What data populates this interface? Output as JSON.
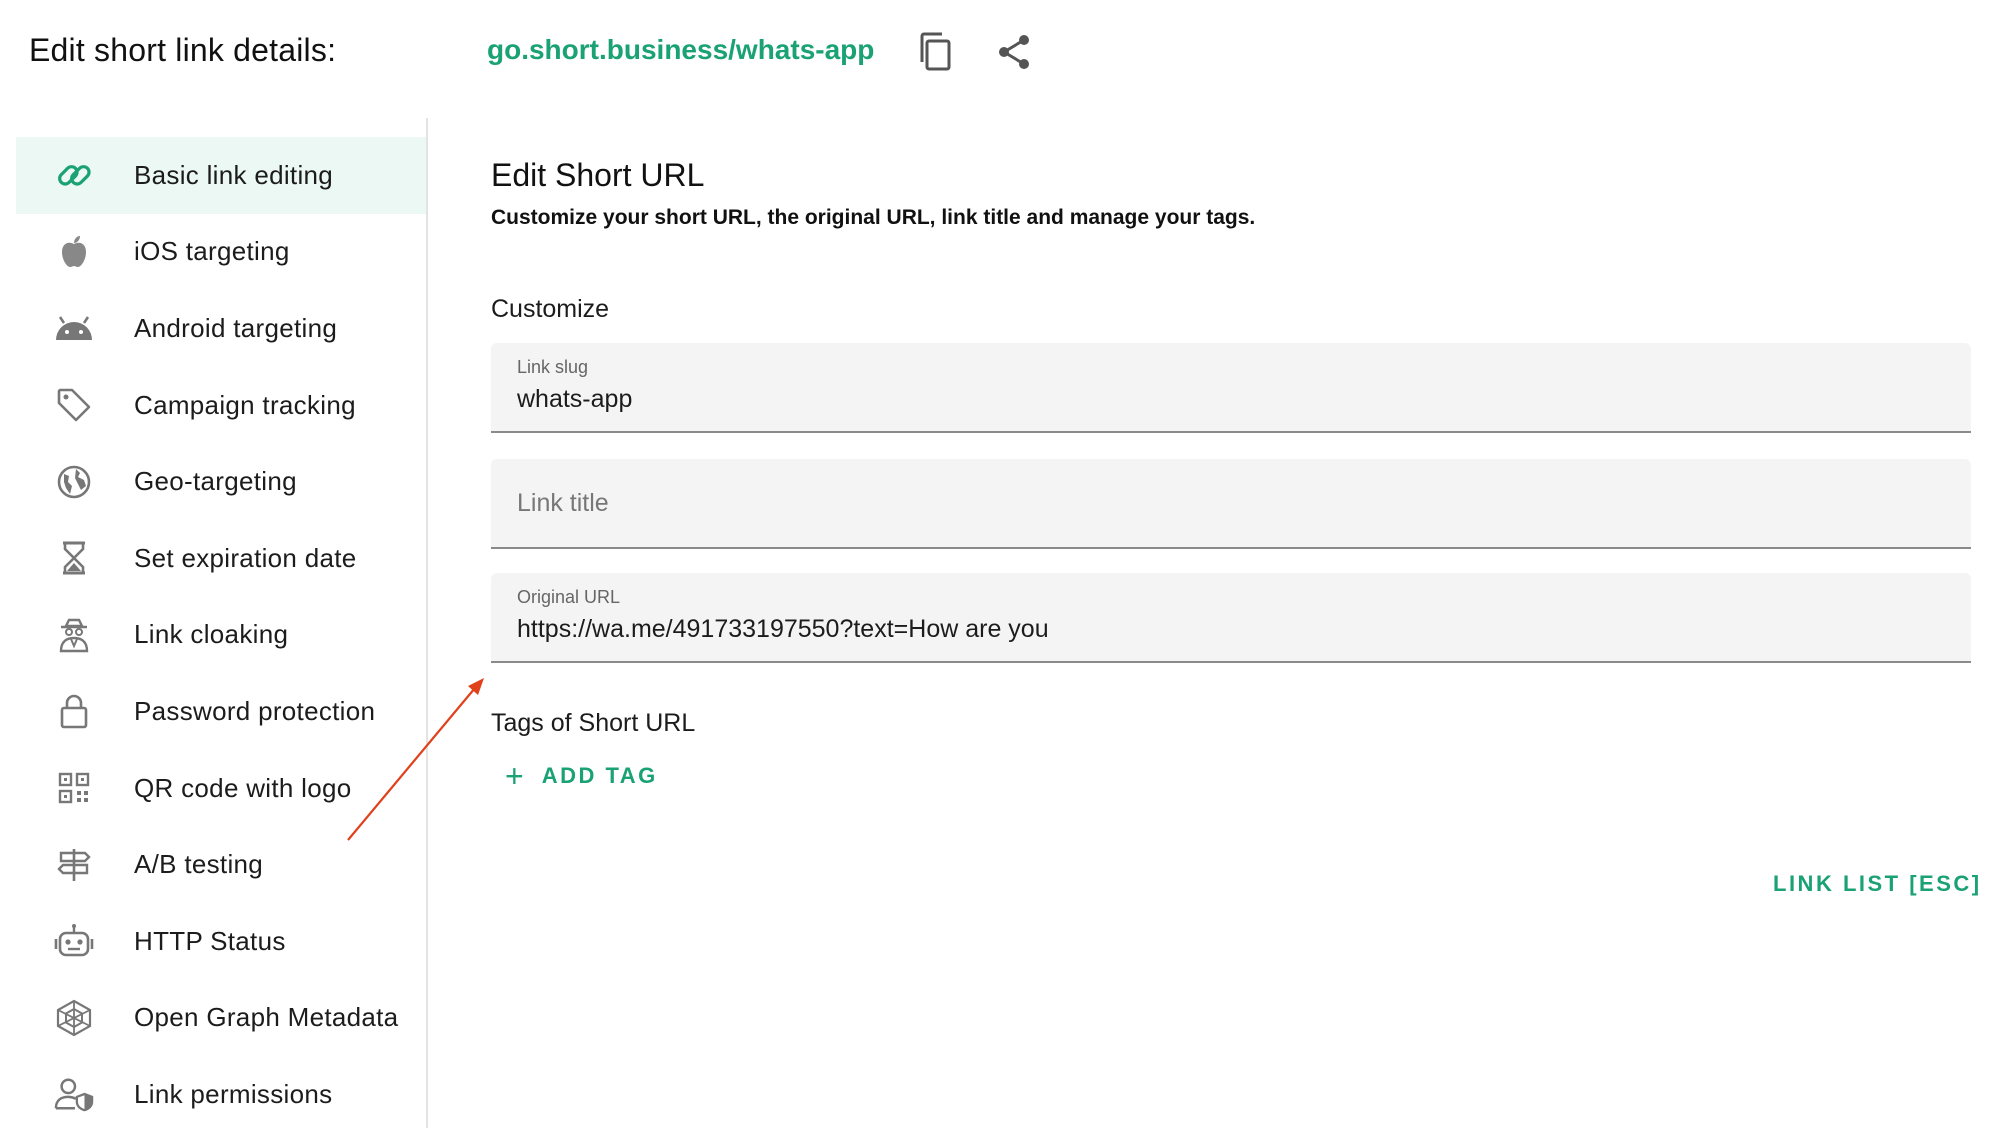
{
  "header": {
    "title": "Edit short link details:",
    "short_url": "go.short.business/whats-app",
    "copy_icon": "copy-icon",
    "share_icon": "share-icon"
  },
  "sidebar": {
    "items": [
      {
        "label": "Basic link editing",
        "icon": "link-icon",
        "active": true
      },
      {
        "label": "iOS targeting",
        "icon": "apple-icon"
      },
      {
        "label": "Android targeting",
        "icon": "android-icon"
      },
      {
        "label": "Campaign tracking",
        "icon": "tag-icon"
      },
      {
        "label": "Geo-targeting",
        "icon": "globe-icon"
      },
      {
        "label": "Set expiration date",
        "icon": "hourglass-icon"
      },
      {
        "label": "Link cloaking",
        "icon": "spy-icon"
      },
      {
        "label": "Password protection",
        "icon": "lock-icon"
      },
      {
        "label": "QR code with logo",
        "icon": "qr-code-icon"
      },
      {
        "label": "A/B testing",
        "icon": "signpost-icon"
      },
      {
        "label": "HTTP Status",
        "icon": "robot-icon"
      },
      {
        "label": "Open Graph Metadata",
        "icon": "web-icon"
      },
      {
        "label": "Link permissions",
        "icon": "user-shield-icon"
      }
    ]
  },
  "main": {
    "title": "Edit Short URL",
    "subtitle": "Customize your short URL, the original URL, link title and manage your tags.",
    "customize_label": "Customize",
    "fields": {
      "slug": {
        "label": "Link slug",
        "value": "whats-app"
      },
      "title": {
        "placeholder": "Link title"
      },
      "original": {
        "label": "Original URL",
        "value": "https://wa.me/491733197550?text=How are you"
      }
    },
    "tags_label": "Tags of Short URL",
    "add_tag_label": "ADD TAG",
    "link_list_label": "LINK LIST [ESC]"
  },
  "colors": {
    "accent": "#1aa174",
    "active_bg": "#ecf8f3",
    "arrow": "#e0401a",
    "icon_gray": "#757575"
  }
}
